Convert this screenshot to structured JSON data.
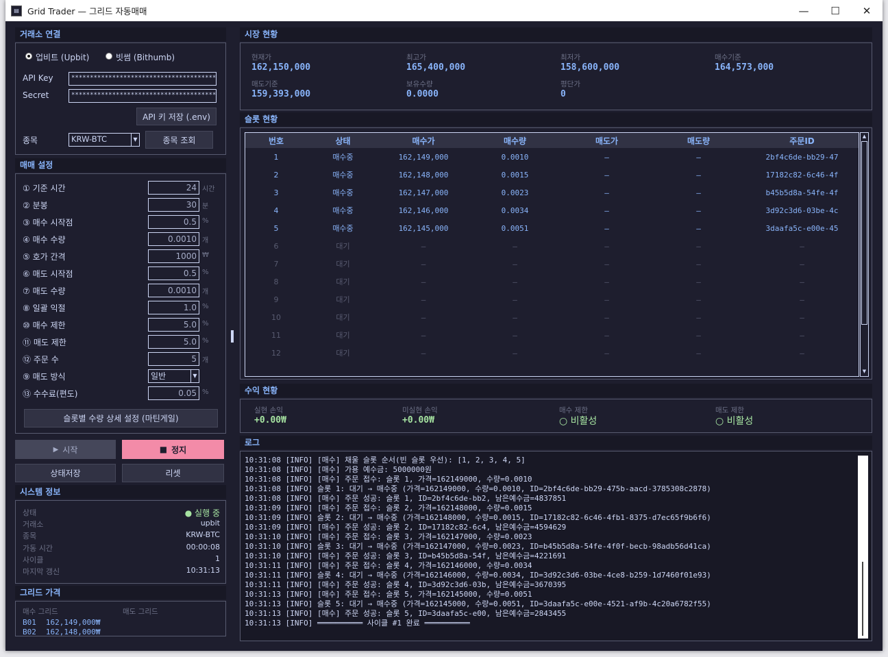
{
  "window": {
    "title": "Grid Trader — 그리드 자동매매",
    "app_icon": "chart-icon"
  },
  "exchange": {
    "section": "거래소 연결",
    "radio_upbit": "업비트 (Upbit)",
    "radio_bithumb": "빗썸 (Bithumb)",
    "selected": "upbit",
    "api_key_label": "API Key",
    "api_key_value": "****************************************",
    "secret_label": "Secret",
    "secret_value": "*******************************************",
    "save_button": "API 키 저장 (.env)",
    "symbol_label": "종목",
    "symbol_value": "KRW-BTC",
    "lookup_button": "종목 조회"
  },
  "settings": {
    "section": "매매 설정",
    "rows": [
      {
        "label": "① 기준 시간",
        "value": "24",
        "unit": "시간"
      },
      {
        "label": "② 분봉",
        "value": "30",
        "unit": "분"
      },
      {
        "label": "③ 매수 시작점",
        "value": "0.5",
        "unit": "%"
      },
      {
        "label": "④ 매수 수량",
        "value": "0.0010",
        "unit": "개"
      },
      {
        "label": "⑤ 호가 간격",
        "value": "1000",
        "unit": "₩"
      },
      {
        "label": "⑥ 매도 시작점",
        "value": "0.5",
        "unit": "%"
      },
      {
        "label": "⑦ 매도 수량",
        "value": "0.0010",
        "unit": "개"
      },
      {
        "label": "⑧ 일괄 익절",
        "value": "1.0",
        "unit": "%"
      },
      {
        "label": "⑩ 매수 제한",
        "value": "5.0",
        "unit": "%"
      },
      {
        "label": "⑪ 매도 제한",
        "value": "5.0",
        "unit": "%"
      },
      {
        "label": "⑫ 주문 수",
        "value": "5",
        "unit": "개"
      },
      {
        "label": "⑨ 매도 방식",
        "value": "일반",
        "unit": ""
      },
      {
        "label": "⑬ 수수료(편도)",
        "value": "0.05",
        "unit": "%"
      }
    ],
    "detail_button": "슬롯별 수량 상세 설정 (마틴게일)"
  },
  "controls": {
    "start": "시작",
    "stop": "정지",
    "save_state": "상태저장",
    "reset": "리셋"
  },
  "system": {
    "section": "시스템 정보",
    "rows": [
      {
        "k": "상태",
        "v": "● 실행 중"
      },
      {
        "k": "거래소",
        "v": "upbit"
      },
      {
        "k": "종목",
        "v": "KRW-BTC"
      },
      {
        "k": "가동 시간",
        "v": "00:00:08"
      },
      {
        "k": "사이클",
        "v": "1"
      },
      {
        "k": "마지막 갱신",
        "v": "10:31:13"
      }
    ],
    "status_color": "#a6e3a1"
  },
  "grid_price": {
    "section": "그리드 가격",
    "buy_header": "매수 그리드",
    "sell_header": "매도 그리드",
    "rows": [
      {
        "id": "B01",
        "price": "162,149,000₩"
      },
      {
        "id": "B02",
        "price": "162,148,000₩"
      }
    ]
  },
  "market": {
    "section": "시장 현황",
    "items": [
      {
        "label": "현재가",
        "value": "162,150,000"
      },
      {
        "label": "최고가",
        "value": "165,400,000"
      },
      {
        "label": "최저가",
        "value": "158,600,000"
      },
      {
        "label": "매수기준",
        "value": "164,573,000"
      },
      {
        "label": "매도기준",
        "value": "159,393,000"
      },
      {
        "label": "보유수량",
        "value": "0.0000"
      },
      {
        "label": "평단가",
        "value": "0"
      }
    ]
  },
  "slots": {
    "section": "슬롯 현황",
    "headers": [
      "번호",
      "상태",
      "매수가",
      "매수량",
      "매도가",
      "매도량",
      "주문ID"
    ],
    "rows": [
      [
        "1",
        "매수중",
        "162,149,000",
        "0.0010",
        "—",
        "—",
        "2bf4c6de-bb29-47"
      ],
      [
        "2",
        "매수중",
        "162,148,000",
        "0.0015",
        "—",
        "—",
        "17182c82-6c46-4f"
      ],
      [
        "3",
        "매수중",
        "162,147,000",
        "0.0023",
        "—",
        "—",
        "b45b5d8a-54fe-4f"
      ],
      [
        "4",
        "매수중",
        "162,146,000",
        "0.0034",
        "—",
        "—",
        "3d92c3d6-03be-4c"
      ],
      [
        "5",
        "매수중",
        "162,145,000",
        "0.0051",
        "—",
        "—",
        "3daafa5c-e00e-45"
      ],
      [
        "6",
        "대기",
        "—",
        "—",
        "—",
        "—",
        "—"
      ],
      [
        "7",
        "대기",
        "—",
        "—",
        "—",
        "—",
        "—"
      ],
      [
        "8",
        "대기",
        "—",
        "—",
        "—",
        "—",
        "—"
      ],
      [
        "9",
        "대기",
        "—",
        "—",
        "—",
        "—",
        "—"
      ],
      [
        "10",
        "대기",
        "—",
        "—",
        "—",
        "—",
        "—"
      ],
      [
        "11",
        "대기",
        "—",
        "—",
        "—",
        "—",
        "—"
      ],
      [
        "12",
        "대기",
        "—",
        "—",
        "—",
        "—",
        "—"
      ]
    ]
  },
  "profit": {
    "section": "수익 현황",
    "realized_label": "실현 손익",
    "realized_value": "+0.00₩",
    "unrealized_label": "미실현 손익",
    "unrealized_value": "+0.00₩",
    "buy_limit_label": "매수 제한",
    "buy_limit_value": "○ 비활성",
    "sell_limit_label": "매도 제한",
    "sell_limit_value": "○ 비활성"
  },
  "log": {
    "section": "로그",
    "lines": [
      "10:31:08 [INFO] [매수] 채울 슬롯 순서(빈 슬롯 우선): [1, 2, 3, 4, 5]",
      "10:31:08 [INFO] [매수] 가용 예수금: 5000000원",
      "10:31:08 [INFO] [매수] 주문 접수: 슬롯 1, 가격=162149000, 수량=0.0010",
      "10:31:08 [INFO] 슬롯 1: 대기 → 매수중 (가격=162149000, 수량=0.0010, ID=2bf4c6de-bb29-475b-aacd-3785308c2878)",
      "10:31:08 [INFO] [매수] 주문 성공: 슬롯 1, ID=2bf4c6de-bb2, 남은예수금=4837851",
      "10:31:09 [INFO] [매수] 주문 접수: 슬롯 2, 가격=162148000, 수량=0.0015",
      "10:31:09 [INFO] 슬롯 2: 대기 → 매수중 (가격=162148000, 수량=0.0015, ID=17182c82-6c46-4fb1-8375-d7ec65f9b6f6)",
      "10:31:09 [INFO] [매수] 주문 성공: 슬롯 2, ID=17182c82-6c4, 남은예수금=4594629",
      "10:31:10 [INFO] [매수] 주문 접수: 슬롯 3, 가격=162147000, 수량=0.0023",
      "10:31:10 [INFO] 슬롯 3: 대기 → 매수중 (가격=162147000, 수량=0.0023, ID=b45b5d8a-54fe-4f0f-becb-98adb56d41ca)",
      "10:31:10 [INFO] [매수] 주문 성공: 슬롯 3, ID=b45b5d8a-54f, 남은예수금=4221691",
      "10:31:11 [INFO] [매수] 주문 접수: 슬롯 4, 가격=162146000, 수량=0.0034",
      "10:31:11 [INFO] 슬롯 4: 대기 → 매수중 (가격=162146000, 수량=0.0034, ID=3d92c3d6-03be-4ce8-b259-1d7460f01e93)",
      "10:31:11 [INFO] [매수] 주문 성공: 슬롯 4, ID=3d92c3d6-03b, 남은예수금=3670395",
      "10:31:13 [INFO] [매수] 주문 접수: 슬롯 5, 가격=162145000, 수량=0.0051",
      "10:31:13 [INFO] 슬롯 5: 대기 → 매수중 (가격=162145000, 수량=0.0051, ID=3daafa5c-e00e-4521-af9b-4c20a6782f55)",
      "10:31:13 [INFO] [매수] 주문 성공: 슬롯 5, ID=3daafa5c-e00, 남은예수금=2843455",
      "10:31:13 [INFO] ══════════ 사이클 #1 완료 ══════════"
    ]
  },
  "colors": {
    "accent": "#89b4fa",
    "stop_button": "#f38ba8",
    "profit_green": "#a6e3a1",
    "background": "#1e1e2e"
  }
}
